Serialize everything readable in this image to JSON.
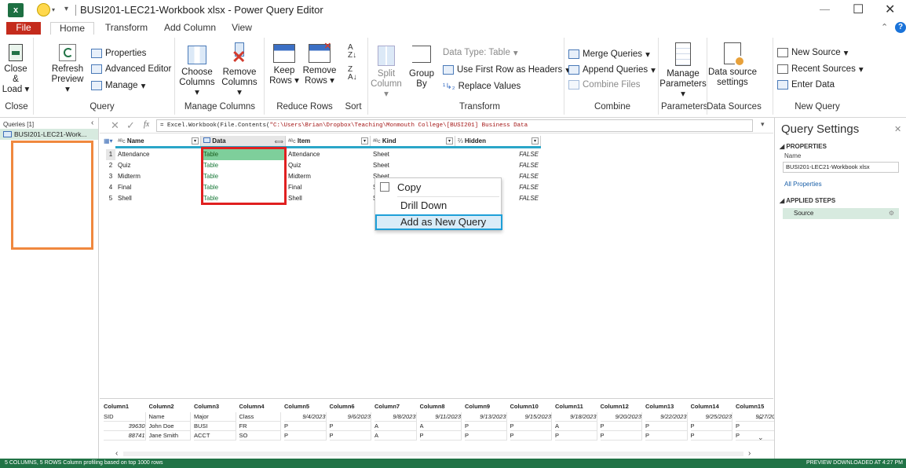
{
  "window": {
    "title": "BUSI201-LEC21-Workbook xlsx - Power Query Editor",
    "minimize": "—",
    "maximize": "☐",
    "close": "✕"
  },
  "tabs": [
    {
      "label": "File"
    },
    {
      "label": "Home"
    },
    {
      "label": "Transform"
    },
    {
      "label": "Add Column"
    },
    {
      "label": "View"
    }
  ],
  "ribbon": {
    "close": {
      "close_load": "Close &",
      "load": "Load",
      "group": "Close"
    },
    "query": {
      "refresh": "Refresh",
      "preview": "Preview",
      "properties": "Properties",
      "advanced_editor": "Advanced Editor",
      "manage": "Manage",
      "group": "Query"
    },
    "manage_columns": {
      "choose": "Choose",
      "choose2": "Columns",
      "remove": "Remove",
      "remove2": "Columns",
      "group": "Manage Columns"
    },
    "reduce_rows": {
      "keep": "Keep",
      "keep2": "Rows",
      "remove": "Remove",
      "remove2": "Rows",
      "group": "Reduce Rows"
    },
    "sort": {
      "group": "Sort"
    },
    "transform": {
      "split": "Split",
      "split2": "Column",
      "group_by": "Group",
      "group_by2": "By",
      "data_type": "Data Type: Table",
      "first_row": "Use First Row as Headers",
      "replace": "Replace Values",
      "group": "Transform"
    },
    "combine": {
      "merge": "Merge Queries",
      "append": "Append Queries",
      "combine_files": "Combine Files",
      "group": "Combine"
    },
    "parameters": {
      "manage": "Manage",
      "manage2": "Parameters",
      "group": "Parameters"
    },
    "data_sources": {
      "label": "Data source",
      "label2": "settings",
      "group": "Data Sources"
    },
    "new_query": {
      "new_source": "New Source",
      "recent_sources": "Recent Sources",
      "enter_data": "Enter Data",
      "group": "New Query"
    }
  },
  "queries": {
    "header": "Queries [1]",
    "items": [
      {
        "label": "BUSI201-LEC21-Work..."
      }
    ]
  },
  "formula": {
    "text_prefix": "= Excel.Workbook(File.Contents(",
    "text_string": "\"C:\\Users\\Brian\\Dropbox\\Teaching\\Monmouth College\\[BUSI201] Business Data"
  },
  "grid": {
    "columns": [
      {
        "type": "ABC",
        "name": "Name"
      },
      {
        "type": "tbl",
        "name": "Data"
      },
      {
        "type": "ABC",
        "name": "Item"
      },
      {
        "type": "ABC",
        "name": "Kind"
      },
      {
        "type": "x",
        "name": "Hidden"
      }
    ],
    "rows": [
      {
        "n": "1",
        "name": "Attendance",
        "data": "Table",
        "item": "Attendance",
        "kind": "Sheet",
        "hidden": "FALSE"
      },
      {
        "n": "2",
        "name": "Quiz",
        "data": "Table",
        "item": "Quiz",
        "kind": "Sheet",
        "hidden": "FALSE"
      },
      {
        "n": "3",
        "name": "Midterm",
        "data": "Table",
        "item": "Midterm",
        "kind": "Sheet",
        "hidden": "FALSE"
      },
      {
        "n": "4",
        "name": "Final",
        "data": "Table",
        "item": "Final",
        "kind": "S",
        "hidden": "FALSE"
      },
      {
        "n": "5",
        "name": "Shell",
        "data": "Table",
        "item": "Shell",
        "kind": "S",
        "hidden": "FALSE"
      }
    ]
  },
  "context_menu": {
    "copy": "Copy",
    "drill_down": "Drill Down",
    "add_as_new_query": "Add as New Query"
  },
  "preview": {
    "headers": [
      "Column1",
      "Column2",
      "Column3",
      "Column4",
      "Column5",
      "Column6",
      "Column7",
      "Column8",
      "Column9",
      "Column10",
      "Column11",
      "Column12",
      "Column13",
      "Column14",
      "Column15"
    ],
    "rows": [
      [
        "SID",
        "Name",
        "Major",
        "Class",
        "9/4/2023",
        "9/6/2023",
        "9/8/2023",
        "9/11/2023",
        "9/13/2023",
        "9/15/2023",
        "9/18/2023",
        "9/20/2023",
        "9/22/2023",
        "9/25/2023",
        "9/27/20."
      ],
      [
        "39630",
        "John Doe",
        "BUSI",
        "FR",
        "P",
        "P",
        "A",
        "A",
        "P",
        "P",
        "A",
        "P",
        "P",
        "P",
        "P"
      ],
      [
        "88741",
        "Jane Smith",
        "ACCT",
        "SO",
        "P",
        "P",
        "A",
        "P",
        "P",
        "P",
        "P",
        "P",
        "P",
        "P",
        "P"
      ]
    ]
  },
  "settings": {
    "title": "Query Settings",
    "properties": "PROPERTIES",
    "name_label": "Name",
    "name_value": "BUSI201-LEC21-Workbook xlsx",
    "all_properties": "All Properties",
    "applied_steps": "APPLIED STEPS",
    "steps": [
      {
        "label": "Source"
      }
    ]
  },
  "status": {
    "left": "5 COLUMNS, 5 ROWS    Column profiling based on top 1000 rows",
    "right": "PREVIEW DOWNLOADED AT 4:27 PM"
  },
  "colors": {
    "excel_green": "#217346",
    "file_red": "#c42b1c",
    "highlight_orange": "#f0883e",
    "highlight_red": "#e02020",
    "highlight_blue": "#1e9fd8",
    "selected_cell": "#7ecf9b",
    "header_underline": "#2aa6c8"
  }
}
